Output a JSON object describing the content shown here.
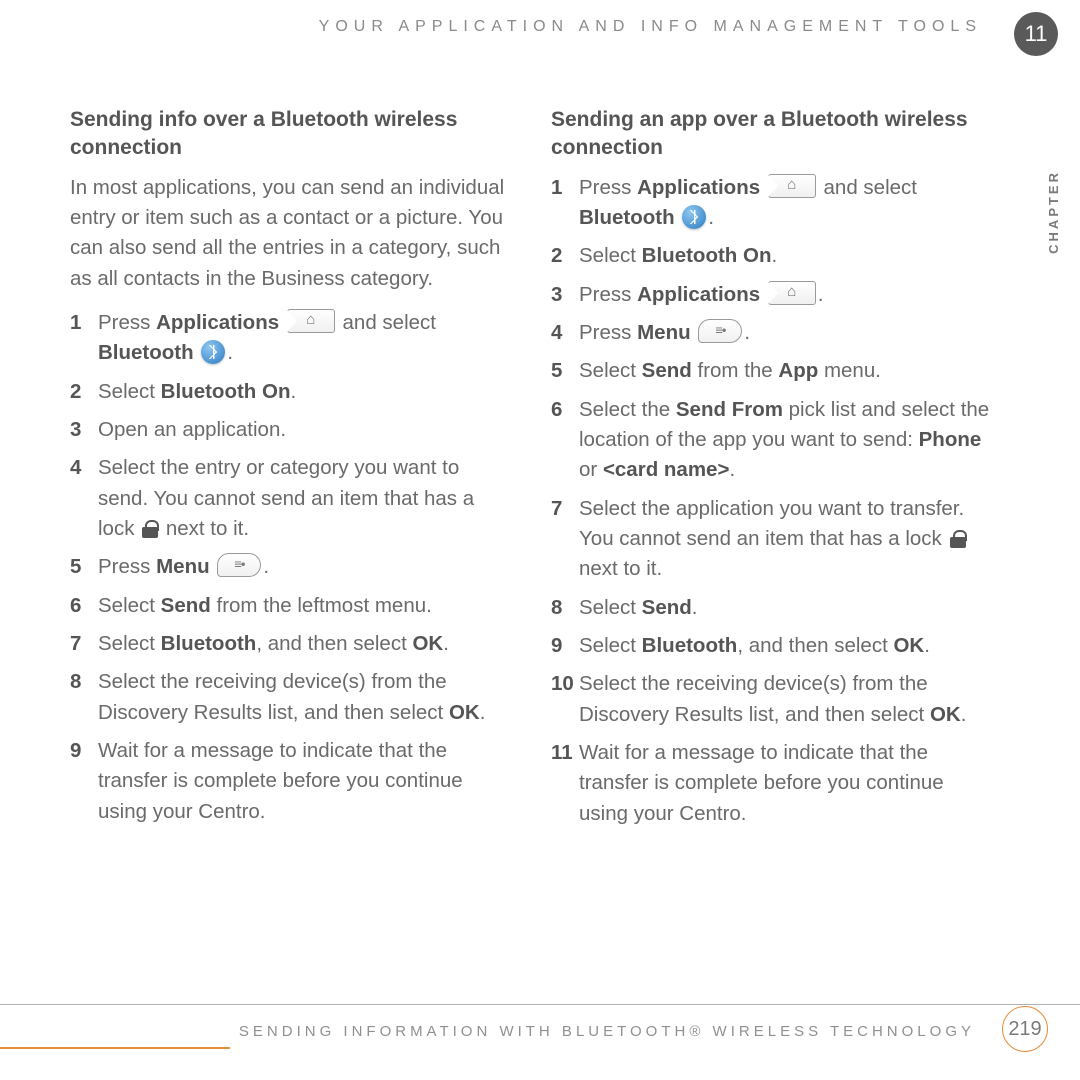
{
  "header": "YOUR APPLICATION AND INFO MANAGEMENT TOOLS",
  "chapter_number": "11",
  "chapter_label": "CHAPTER",
  "footer_text": "SENDING INFORMATION WITH BLUETOOTH® WIRELESS TECHNOLOGY",
  "page_number": "219",
  "left": {
    "title": "Sending info over a Bluetooth wireless connection",
    "intro": "In most applications, you can send an individual entry or item such as a contact or a picture. You can also send all the entries in a category, such as all contacts in the Business category.",
    "steps": {
      "s1a": "Press ",
      "s1b": "Applications",
      "s1c": " and select ",
      "s1d": "Bluetooth",
      "s1e": ".",
      "s2a": "Select ",
      "s2b": "Bluetooth On",
      "s2c": ".",
      "s3": "Open an application.",
      "s4a": "Select the entry or category you want to send. You cannot send an item that has a lock ",
      "s4b": " next to it.",
      "s5a": "Press ",
      "s5b": "Menu",
      "s5c": ".",
      "s6a": "Select ",
      "s6b": "Send",
      "s6c": " from the leftmost menu.",
      "s7a": "Select ",
      "s7b": "Bluetooth",
      "s7c": ", and then select ",
      "s7d": "OK",
      "s7e": ".",
      "s8a": "Select the receiving device(s) from the Discovery Results list, and then select ",
      "s8b": "OK",
      "s8c": ".",
      "s9": "Wait for a message to indicate that the transfer is complete before you continue using your Centro."
    }
  },
  "right": {
    "title": "Sending an app over a Bluetooth wireless connection",
    "steps": {
      "s1a": "Press ",
      "s1b": "Applications",
      "s1c": " and select ",
      "s1d": "Bluetooth",
      "s1e": ".",
      "s2a": "Select ",
      "s2b": "Bluetooth On",
      "s2c": ".",
      "s3a": "Press ",
      "s3b": "Applications",
      "s3c": ".",
      "s4a": "Press ",
      "s4b": "Menu",
      "s4c": ".",
      "s5a": "Select ",
      "s5b": "Send",
      "s5c": " from the ",
      "s5d": "App",
      "s5e": " menu.",
      "s6a": "Select the ",
      "s6b": "Send From",
      "s6c": " pick list and select the location of the app you want to send: ",
      "s6d": "Phone",
      "s6e": " or ",
      "s6f": "<card name>",
      "s6g": ".",
      "s7a": "Select the application you want to transfer. You cannot send an item that has a lock ",
      "s7b": " next to it.",
      "s8a": "Select ",
      "s8b": "Send",
      "s8c": ".",
      "s9a": "Select ",
      "s9b": "Bluetooth",
      "s9c": ", and then select ",
      "s9d": "OK",
      "s9e": ".",
      "s10a": "Select the receiving device(s) from the Discovery Results list, and then select ",
      "s10b": "OK",
      "s10c": ".",
      "s11": "Wait for a message to indicate that the transfer is complete before you continue using your Centro."
    }
  },
  "nums": {
    "n1": "1",
    "n2": "2",
    "n3": "3",
    "n4": "4",
    "n5": "5",
    "n6": "6",
    "n7": "7",
    "n8": "8",
    "n9": "9",
    "n10": "10",
    "n11": "11"
  }
}
